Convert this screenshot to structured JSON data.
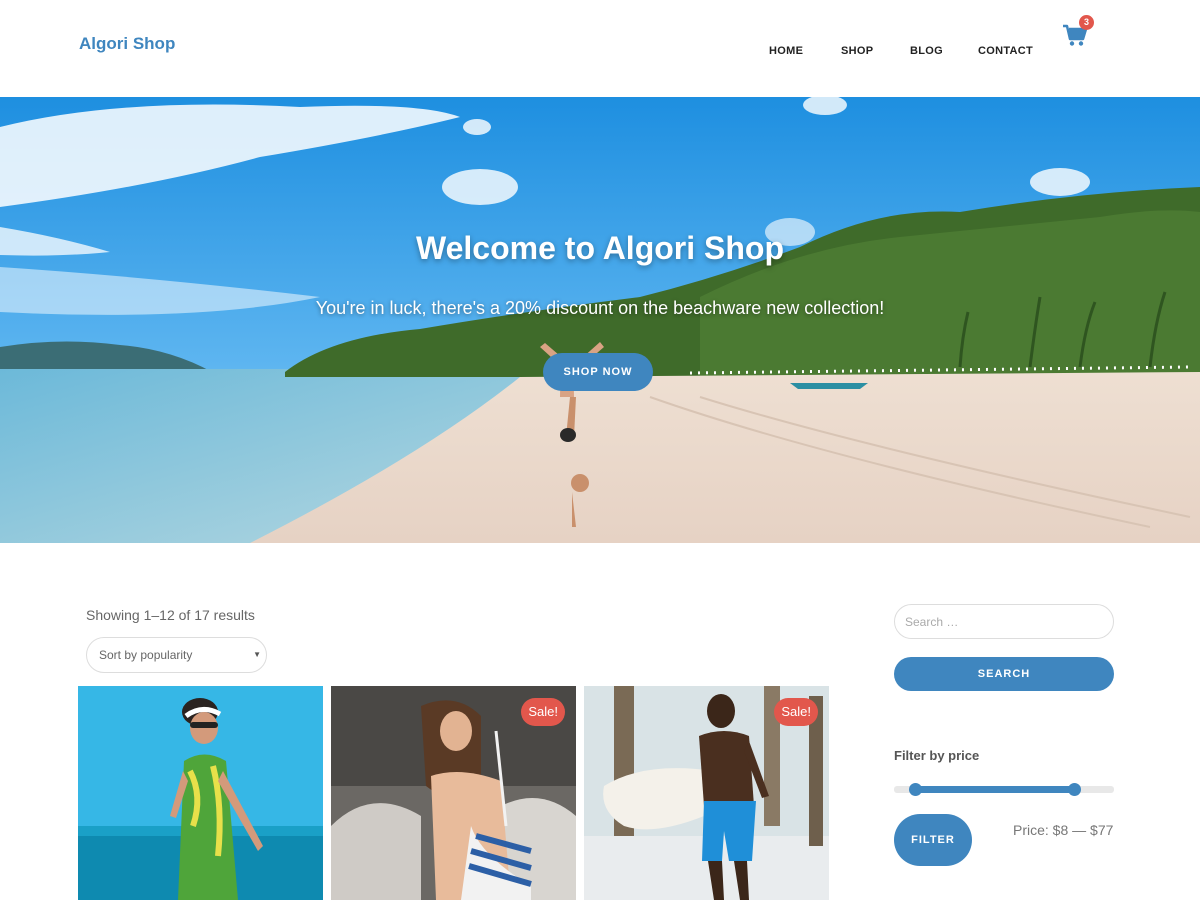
{
  "header": {
    "logo": "Algori Shop",
    "nav": [
      {
        "label": "HOME"
      },
      {
        "label": "SHOP"
      },
      {
        "label": "BLOG"
      },
      {
        "label": "CONTACT"
      }
    ],
    "cart_count": "3",
    "cart_icon": "shopping-cart-icon"
  },
  "hero": {
    "title": "Welcome to Algori Shop",
    "subtitle": "You're in luck, there's a 20% discount on the beachware new collection!",
    "button": "SHOP NOW"
  },
  "shop": {
    "result_count": "Showing 1–12 of 17 results",
    "sort_selected": "Sort by popularity",
    "products": [
      {
        "image": "woman in green sarong on beach",
        "sale": false
      },
      {
        "image": "woman in striped swimsuit on rocks",
        "sale": true,
        "badge": "Sale!"
      },
      {
        "image": "man with surfboard on beach",
        "sale": true,
        "badge": "Sale!"
      }
    ]
  },
  "sidebar": {
    "search_placeholder": "Search …",
    "search_button": "SEARCH",
    "filter_title": "Filter by price",
    "filter_button": "FILTER",
    "price_label": "Price: $8 — $77"
  },
  "colors": {
    "accent": "#3f86bf",
    "sale": "#e2574c"
  }
}
